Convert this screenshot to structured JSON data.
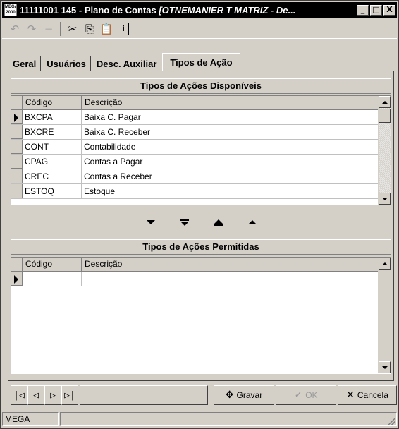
{
  "window": {
    "icon_text": [
      "MEGA",
      "2000"
    ],
    "title_plain": "11111001 145 - Plano de Contas ",
    "title_italic": "[OTNEMANIER T MATRIZ - De...",
    "controls": {
      "minimize": "_",
      "maximize": "□",
      "close": "X"
    }
  },
  "toolbar": {
    "undo": "↶",
    "redo": "↷",
    "delete": "═",
    "cut": "✂",
    "copy": "⎘",
    "paste": "📋",
    "info": "i"
  },
  "tabs": [
    {
      "label_pre": "",
      "label_ul": "G",
      "label_post": "eral"
    },
    {
      "label_pre": "",
      "label_ul": "",
      "label_post": "Usuários"
    },
    {
      "label_pre": "",
      "label_ul": "D",
      "label_post": "esc. Auxiliar"
    },
    {
      "label_pre": "",
      "label_ul": "",
      "label_post": "Tipos de Ação"
    }
  ],
  "available": {
    "title": "Tipos de Ações Disponíveis",
    "col_code": "Código",
    "col_desc": "Descrição",
    "rows": [
      {
        "code": "BXCPA",
        "desc": "Baixa C. Pagar"
      },
      {
        "code": "BXCRE",
        "desc": "Baixa C. Receber"
      },
      {
        "code": "CONT",
        "desc": "Contabilidade"
      },
      {
        "code": "CPAG",
        "desc": "Contas a Pagar"
      },
      {
        "code": "CREC",
        "desc": "Contas a Receber"
      },
      {
        "code": "ESTOQ",
        "desc": "Estoque"
      }
    ]
  },
  "allowed": {
    "title": "Tipos de Ações Permitidas",
    "col_code": "Código",
    "col_desc": "Descrição",
    "rows": [
      {
        "code": "",
        "desc": ""
      }
    ]
  },
  "nav": {
    "first": "|◁",
    "prev": "◁",
    "next": "▷",
    "last": "▷|"
  },
  "actions": {
    "gravar_ul": "G",
    "gravar_rest": "ravar",
    "gravar_icon": "✥",
    "ok_ul": "O",
    "ok_rest": "K",
    "ok_icon": "✓",
    "cancela_ul": "C",
    "cancela_rest": "ancela",
    "cancela_icon": "✕"
  },
  "status": {
    "left": "MEGA",
    "right": ""
  }
}
